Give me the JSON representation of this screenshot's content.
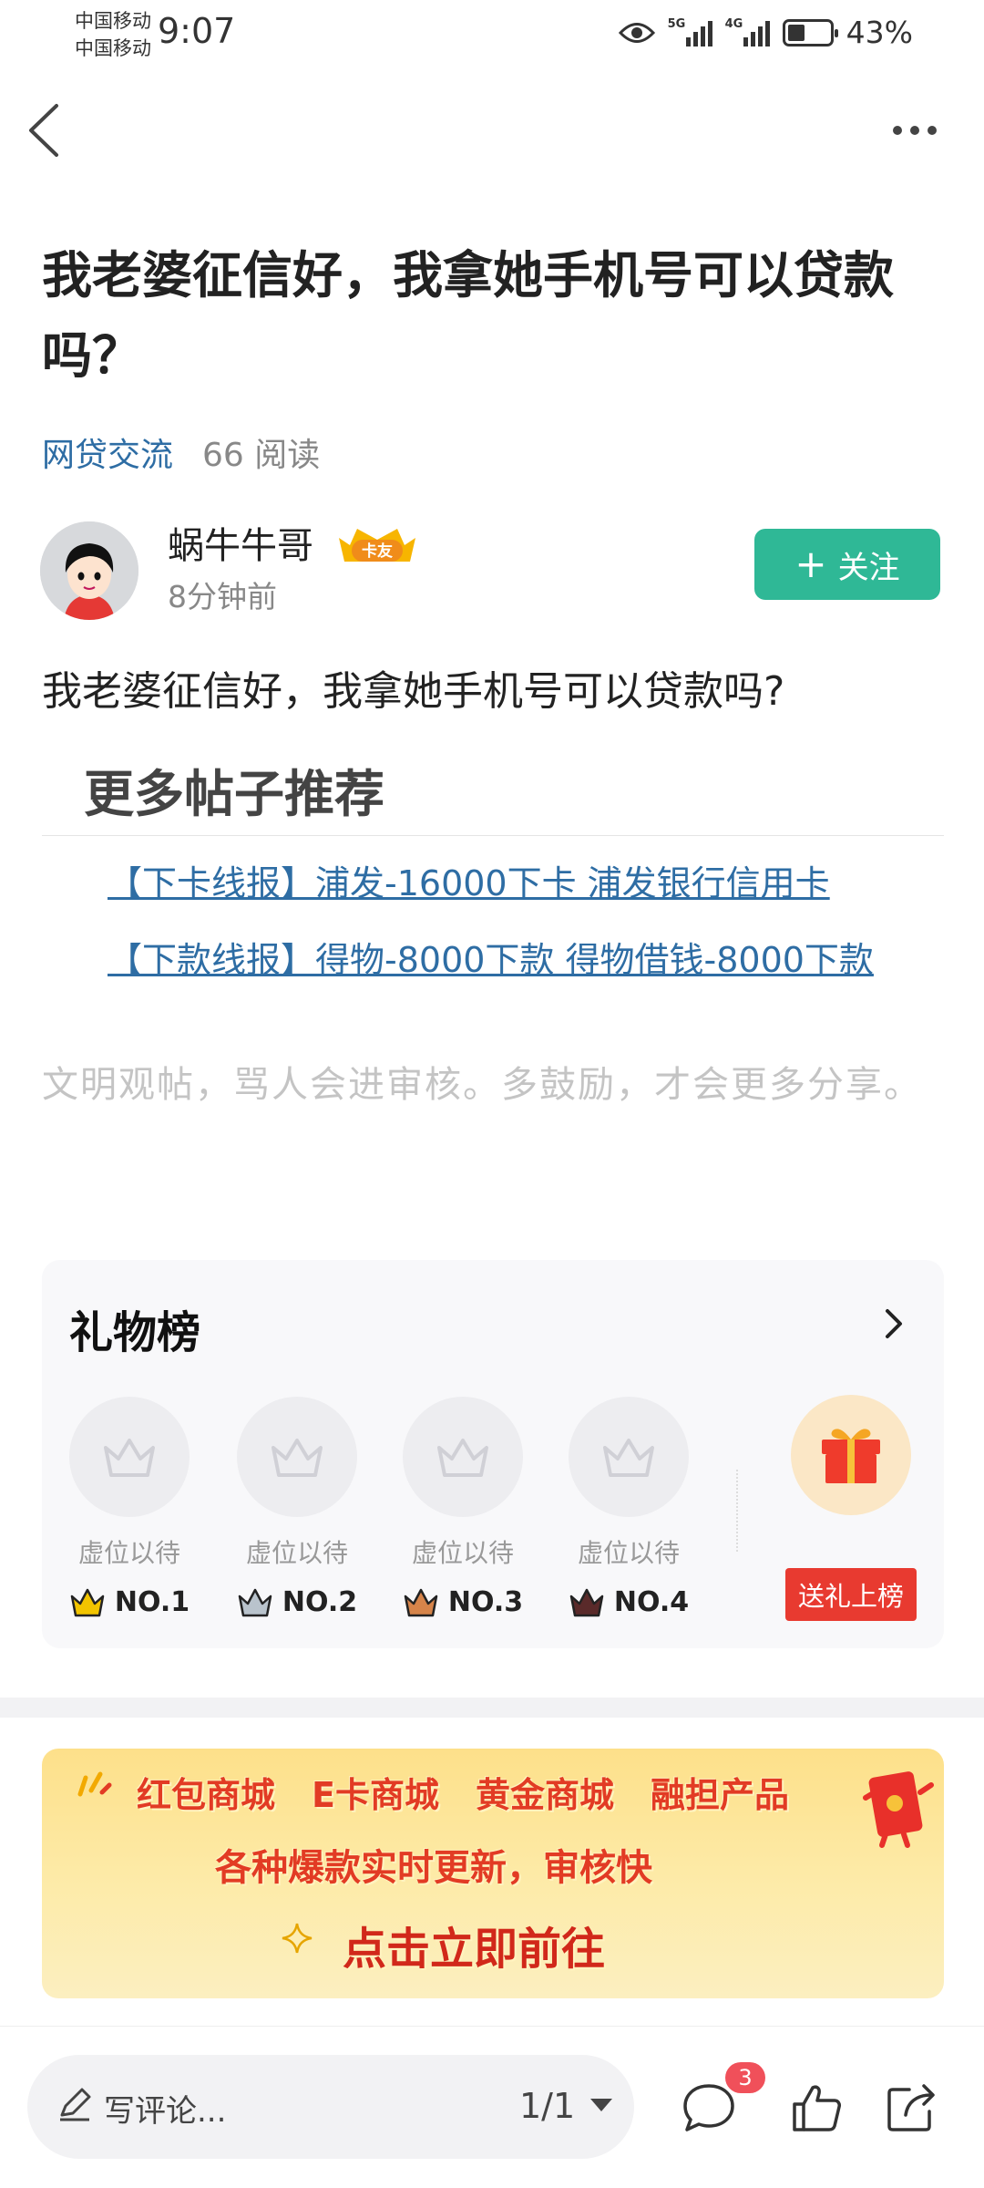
{
  "status_bar": {
    "carrier_1": "中国移动",
    "carrier_2": "中国移动",
    "time": "9:07",
    "signal_1_tag": "5G",
    "signal_2_tag": "4G",
    "battery": "43%"
  },
  "post": {
    "title": "我老婆征信好，我拿她手机号可以贷款吗？",
    "category": "网贷交流",
    "reads": "66 阅读",
    "author": {
      "name": "蜗牛牛哥",
      "badge": "卡友",
      "time": "8分钟前"
    },
    "follow_label": "关注",
    "follow_plus": "+",
    "body": "我老婆征信好，我拿她手机号可以贷款吗?"
  },
  "recommend": {
    "heading": "更多帖子推荐",
    "links": [
      "【下卡线报】浦发-16000下卡 浦发银行信用卡",
      "【下款线报】得物-8000下款 得物借钱-8000下款"
    ]
  },
  "notice": "文明观帖，骂人会进审核。多鼓励，才会更多分享。",
  "gift_board": {
    "title": "礼物榜",
    "slots": [
      {
        "label": "虚位以待",
        "rank": "NO.1",
        "color": "#f2c400"
      },
      {
        "label": "虚位以待",
        "rank": "NO.2",
        "color": "#b9c3cc"
      },
      {
        "label": "虚位以待",
        "rank": "NO.3",
        "color": "#d6844a"
      },
      {
        "label": "虚位以待",
        "rank": "NO.4",
        "color": "#5a2a2a"
      }
    ],
    "send_gift": "送礼上榜"
  },
  "banner": {
    "items": [
      "红包商城",
      "E卡商城",
      "黄金商城",
      "融担产品"
    ],
    "tagline": "各种爆款实时更新，审核快",
    "cta": "点击立即前往"
  },
  "bottom_bar": {
    "comment_placeholder": "写评论...",
    "pager": "1/1",
    "comment_count": "3"
  }
}
